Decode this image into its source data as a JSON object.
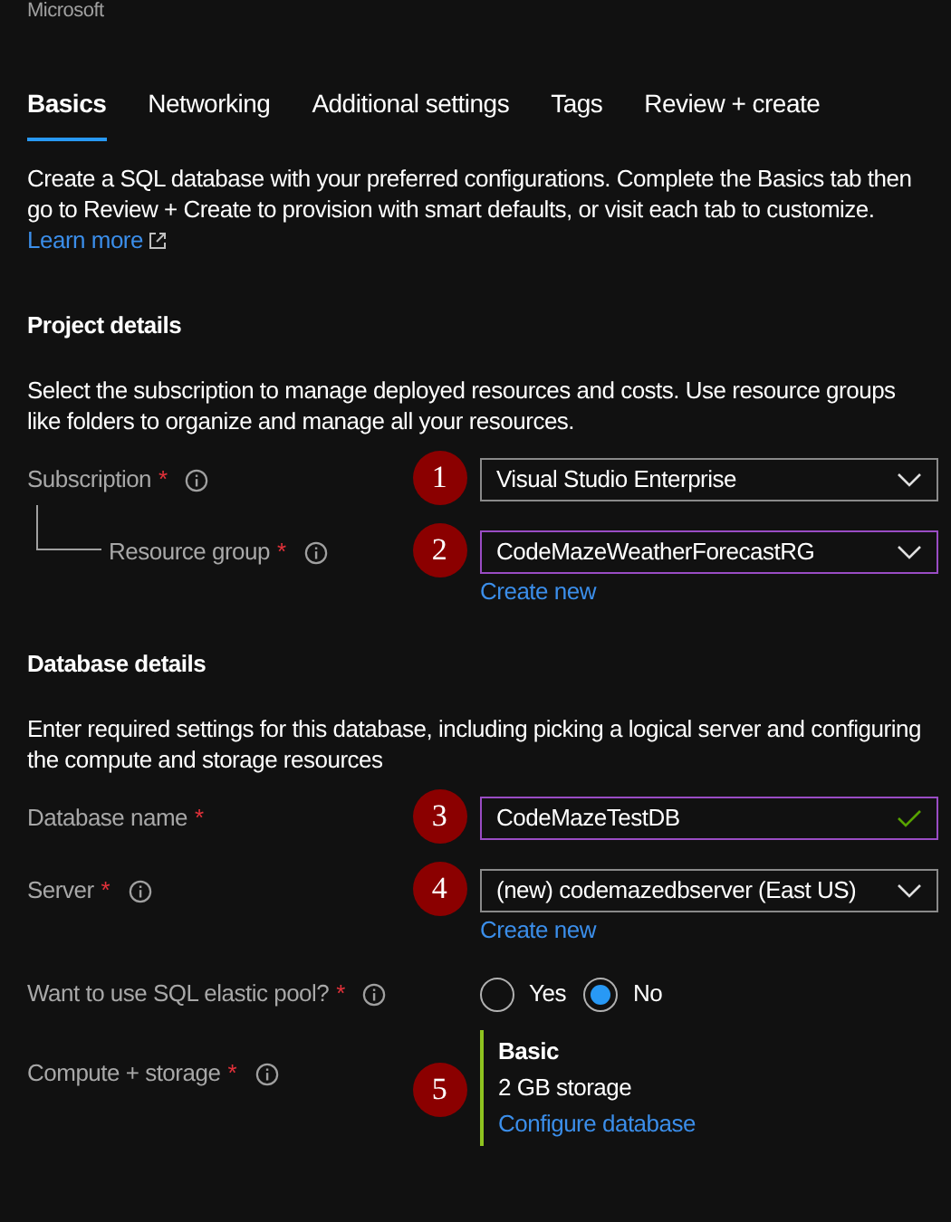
{
  "header": {
    "publisher": "Microsoft"
  },
  "tabs": [
    {
      "label": "Basics",
      "selected": true
    },
    {
      "label": "Networking",
      "selected": false
    },
    {
      "label": "Additional settings",
      "selected": false
    },
    {
      "label": "Tags",
      "selected": false
    },
    {
      "label": "Review + create",
      "selected": false
    }
  ],
  "intro": {
    "text": "Create a SQL database with your preferred configurations. Complete the Basics tab then go to Review + Create to provision with smart defaults, or visit each tab to customize.",
    "link": "Learn more"
  },
  "sections": [
    {
      "title": "Project details",
      "description": "Select the subscription to manage deployed resources and costs. Use resource groups like folders to organize and manage all your resources.",
      "fields": [
        {
          "kind": "dropdown",
          "label": "Subscription",
          "required": "*",
          "info": true,
          "nested": false,
          "badge": "1",
          "value": "Visual Studio Enterprise",
          "focused": false
        },
        {
          "kind": "dropdown",
          "label": "Resource group",
          "required": "*",
          "info": true,
          "nested": true,
          "badge": "2",
          "value": "CodeMazeWeatherForecastRG",
          "focused": true,
          "link": "Create new"
        }
      ]
    },
    {
      "title": "Database details",
      "description": "Enter required settings for this database, including picking a logical server and configuring the compute and storage resources",
      "fields": [
        {
          "kind": "text",
          "label": "Database name",
          "required": "*",
          "info": false,
          "nested": false,
          "badge": "3",
          "value": "CodeMazeTestDB",
          "focused": true,
          "valid": true
        },
        {
          "kind": "dropdown",
          "label": "Server",
          "required": "*",
          "info": true,
          "nested": false,
          "badge": "4",
          "value": "(new) codemazedbserver (East US)",
          "focused": false,
          "link": "Create new"
        },
        {
          "kind": "radio",
          "label": "Want to use SQL elastic pool?",
          "required": "*",
          "info": true,
          "nested": false,
          "options": [
            {
              "label": "Yes",
              "selected": false
            },
            {
              "label": "No",
              "selected": true
            }
          ]
        },
        {
          "kind": "summary",
          "label": "Compute + storage",
          "required": "*",
          "info": true,
          "nested": false,
          "badge": "5",
          "tier": "Basic",
          "detail": "2 GB storage",
          "link": "Configure database"
        }
      ]
    }
  ]
}
